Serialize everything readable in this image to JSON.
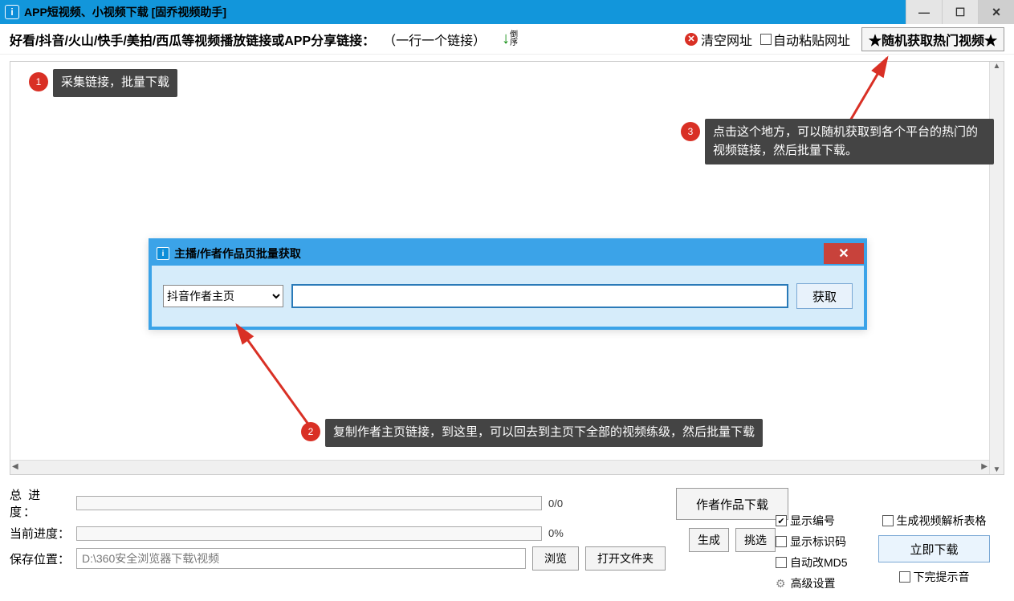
{
  "titlebar": {
    "title": "APP短视频、小视频下载 [固乔视频助手]"
  },
  "toolbar": {
    "instruction": "好看/抖音/火山/快手/美拍/西瓜等视频播放链接或APP分享链接：",
    "hint": "（一行一个链接）",
    "sort_label": "倒序",
    "clear_label": "清空网址",
    "auto_paste_label": "自动粘贴网址",
    "hot_button": "★随机获取热门视频★"
  },
  "annotations": {
    "a1": {
      "num": "1",
      "text": "采集链接，批量下载"
    },
    "a2": {
      "num": "2",
      "text": "复制作者主页链接，到这里，可以回去到主页下全部的视频练级，然后批量下载"
    },
    "a3": {
      "num": "3",
      "text": "点击这个地方，可以随机获取到各个平台的热门的视频链接，然后批量下载。"
    }
  },
  "dialog": {
    "title": "主播/作者作品页批量获取",
    "select_value": "抖音作者主页",
    "get_button": "获取"
  },
  "bottom": {
    "total_label": "总 进 度：",
    "total_value": "0/0",
    "current_label": "当前进度：",
    "current_value": "0%",
    "save_label": "保存位置：",
    "save_path": "D:\\360安全浏览器下载\\视频",
    "browse": "浏览",
    "open_folder": "打开文件夹",
    "author_download": "作者作品下载",
    "generate": "生成",
    "pick": "挑选",
    "show_index": "显示编号",
    "show_id": "显示标识码",
    "auto_md5": "自动改MD5",
    "advanced": "高级设置",
    "gen_table": "生成视频解析表格",
    "download_now": "立即下载",
    "done_sound": "下完提示音"
  }
}
